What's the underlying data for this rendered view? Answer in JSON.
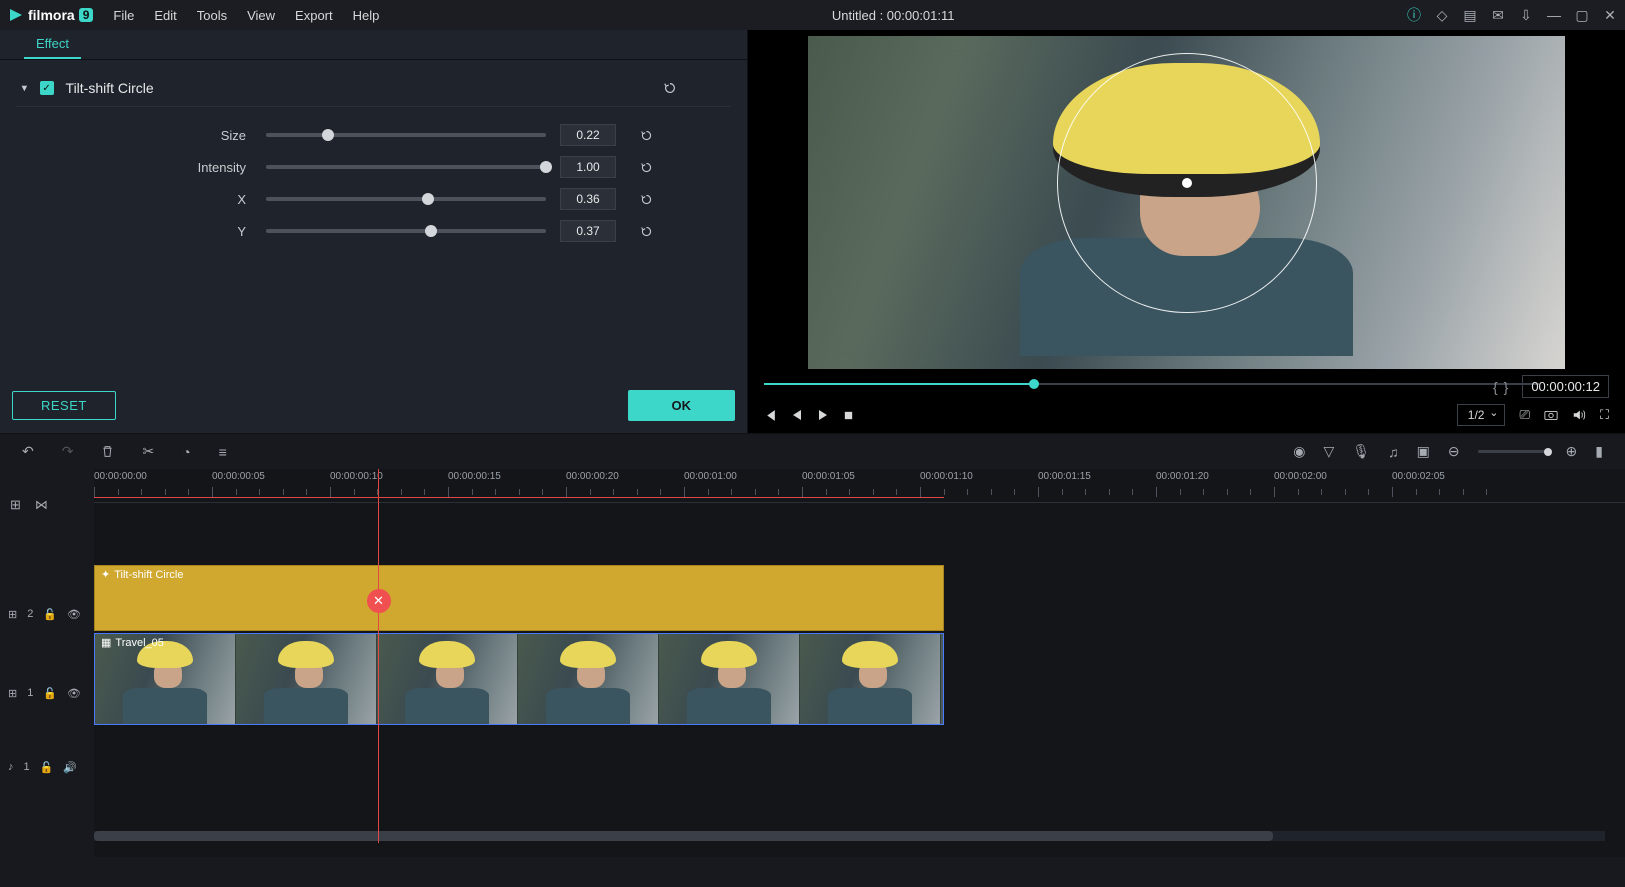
{
  "app": {
    "name": "filmora",
    "version": "9",
    "title": "Untitled : 00:00:01:11"
  },
  "menu": [
    "File",
    "Edit",
    "Tools",
    "View",
    "Export",
    "Help"
  ],
  "effect": {
    "tab": "Effect",
    "name": "Tilt-shift Circle",
    "params": [
      {
        "label": "Size",
        "value": "0.22",
        "pct": 22
      },
      {
        "label": "Intensity",
        "value": "1.00",
        "pct": 100
      },
      {
        "label": "X",
        "value": "0.36",
        "pct": 58
      },
      {
        "label": "Y",
        "value": "0.37",
        "pct": 59
      }
    ],
    "reset": "RESET",
    "ok": "OK"
  },
  "preview": {
    "timecode": "00:00:00:12",
    "scale": "1/2"
  },
  "ruler": [
    "00:00:00:00",
    "00:00:00:05",
    "00:00:00:10",
    "00:00:00:15",
    "00:00:00:20",
    "00:00:01:00",
    "00:00:01:05",
    "00:00:01:10",
    "00:00:01:15",
    "00:00:01:20",
    "00:00:02:00",
    "00:00:02:05"
  ],
  "tracks": {
    "fx": {
      "num": "2",
      "clip": "Tilt-shift Circle"
    },
    "vid": {
      "num": "1",
      "clip": "Travel_05"
    },
    "aud": {
      "num": "1"
    }
  }
}
